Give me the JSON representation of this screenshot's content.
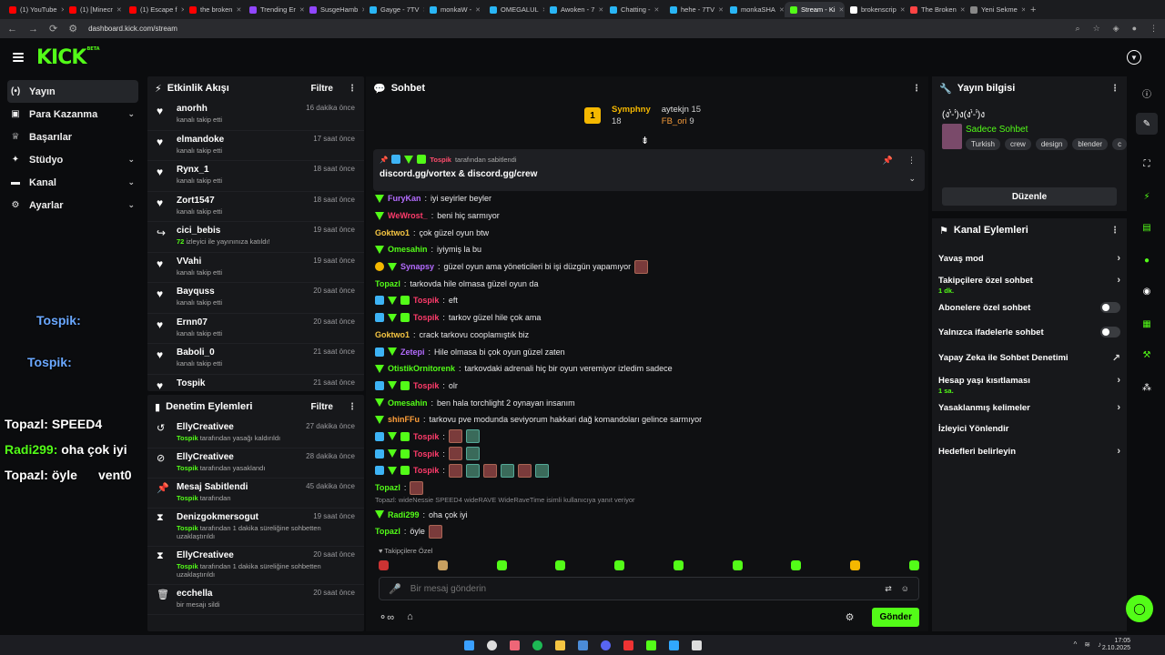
{
  "browser": {
    "tabs": [
      {
        "label": "(1) YouTube",
        "color": "#ff0000"
      },
      {
        "label": "(1) [Minecr",
        "color": "#ff0000"
      },
      {
        "label": "(1) Escape f",
        "color": "#ff0000"
      },
      {
        "label": "the broken",
        "color": "#ff0000"
      },
      {
        "label": "Trending Er",
        "color": "#9146ff"
      },
      {
        "label": "SusgeHamb",
        "color": "#9146ff"
      },
      {
        "label": "Gayge - 7TV",
        "color": "#29b6f6"
      },
      {
        "label": "monkaW -",
        "color": "#29b6f6"
      },
      {
        "label": "OMEGALUL",
        "color": "#29b6f6"
      },
      {
        "label": "Awoken - 7",
        "color": "#29b6f6"
      },
      {
        "label": "Chatting -",
        "color": "#29b6f6"
      },
      {
        "label": "hehe - 7TV",
        "color": "#29b6f6"
      },
      {
        "label": "monkaSHA",
        "color": "#29b6f6"
      },
      {
        "label": "Stream - Ki",
        "color": "#53fc18"
      },
      {
        "label": "brokenscrip",
        "color": "#ffffff"
      },
      {
        "label": "The Broken",
        "color": "#ff4444"
      },
      {
        "label": "Yeni Sekme",
        "color": "#888888"
      }
    ],
    "active_tab": 13,
    "url": "dashboard.kick.com/stream"
  },
  "brand": {
    "logo": "KICK",
    "sup": "BETA",
    "accent": "#53fc18"
  },
  "nav": {
    "items": [
      {
        "label": "Yayın",
        "icon": "broadcast-icon",
        "selected": true,
        "chev": false
      },
      {
        "label": "Para Kazanma",
        "icon": "money-icon",
        "selected": false,
        "chev": true
      },
      {
        "label": "Başarılar",
        "icon": "trophy-icon",
        "selected": false,
        "chev": false
      },
      {
        "label": "Stüdyo",
        "icon": "studio-icon",
        "selected": false,
        "chev": true
      },
      {
        "label": "Kanal",
        "icon": "channel-icon",
        "selected": false,
        "chev": true
      },
      {
        "label": "Ayarlar",
        "icon": "gear-icon",
        "selected": false,
        "chev": true
      }
    ]
  },
  "overlay": {
    "lines": [
      {
        "name": "Tospik:",
        "text": ""
      },
      {
        "name": "Tospik:",
        "text": ""
      },
      {
        "name": "Topazl:",
        "text": "SPEED4"
      },
      {
        "name": "Radi299:",
        "text": "oha çok iyi"
      },
      {
        "name": "Topazl:",
        "text": "öyle"
      },
      {
        "name": "",
        "text": "vent0"
      }
    ]
  },
  "activity": {
    "title": "Etkinlik Akışı",
    "filter": "Filtre",
    "items": [
      {
        "name": "anorhh",
        "sub": "kanalı takip etti",
        "time": "16 dakika önce",
        "icon": "heart-icon"
      },
      {
        "name": "elmandoke",
        "sub": "kanalı takip etti",
        "time": "17 saat önce",
        "icon": "heart-icon"
      },
      {
        "name": "Rynx_1",
        "sub": "kanalı takip etti",
        "time": "18 saat önce",
        "icon": "heart-icon"
      },
      {
        "name": "Zort1547",
        "sub": "kanalı takip etti",
        "time": "18 saat önce",
        "icon": "heart-icon"
      },
      {
        "name": "cici_bebis",
        "sub_num": "72",
        "sub": "izleyici ile yayınınıza katıldı!",
        "time": "19 saat önce",
        "icon": "raid-icon"
      },
      {
        "name": "VVahi",
        "sub": "kanalı takip etti",
        "time": "19 saat önce",
        "icon": "heart-icon"
      },
      {
        "name": "Bayquss",
        "sub": "kanalı takip etti",
        "time": "20 saat önce",
        "icon": "heart-icon"
      },
      {
        "name": "Ernn07",
        "sub": "kanalı takip etti",
        "time": "20 saat önce",
        "icon": "heart-icon"
      },
      {
        "name": "Baboli_0",
        "sub": "kanalı takip etti",
        "time": "21 saat önce",
        "icon": "heart-icon"
      },
      {
        "name": "Tospik",
        "sub": "",
        "time": "21 saat önce",
        "icon": "heart-icon"
      }
    ]
  },
  "moderation": {
    "title": "Denetim Eylemleri",
    "filter": "Filtre",
    "items": [
      {
        "name": "EllyCreativee",
        "actor": "Tospik",
        "sub": "tarafından yasağı kaldırıldı",
        "time": "27 dakika önce",
        "icon": "unban-icon"
      },
      {
        "name": "EllyCreativee",
        "actor": "Tospik",
        "sub": "tarafından yasaklandı",
        "time": "28 dakika önce",
        "icon": "ban-icon"
      },
      {
        "name": "Mesaj Sabitlendi",
        "actor": "Tospik",
        "sub": "tarafından",
        "time": "45 dakika önce",
        "icon": "pin-icon"
      },
      {
        "name": "Denizgokmersogut",
        "actor": "Tospik",
        "sub": "tarafından 1 dakika süreliğine sohbetten uzaklaştırıldı",
        "time": "19 saat önce",
        "icon": "timeout-icon"
      },
      {
        "name": "EllyCreativee",
        "actor": "Tospik",
        "sub": "tarafından 1 dakika süreliğine sohbetten uzaklaştırıldı",
        "time": "20 saat önce",
        "icon": "timeout-icon"
      },
      {
        "name": "ecchella",
        "actor": "",
        "sub": "bir mesajı sildi",
        "time": "20 saat önce",
        "icon": "trash-icon"
      }
    ]
  },
  "chat": {
    "title": "Sohbet",
    "gifters": [
      {
        "name": "Symphny",
        "count": "18"
      },
      {
        "name": "aytekjn",
        "count": "15"
      },
      {
        "name": "FB_ori",
        "count": "9"
      }
    ],
    "gifter_rank": "1",
    "pinned": {
      "by": "Tospik",
      "note": "tarafından sabitlendi",
      "text": "discord.gg/vortex & discord.gg/crew"
    },
    "messages": [
      {
        "user": "FuryKan",
        "color": "#b46cff",
        "text": "iyi seyirler beyler",
        "badges": [
          "vip"
        ]
      },
      {
        "user": "WeWrost_",
        "color": "#ff3b6b",
        "text": "beni hiç sarmıyor",
        "badges": [
          "vip"
        ]
      },
      {
        "user": "Goktwo1",
        "color": "#f5c542",
        "text": "çok güzel oyun btw",
        "badges": []
      },
      {
        "user": "Omesahin",
        "color": "#53fc18",
        "text": "iyiymiş la bu",
        "badges": [
          "vip"
        ]
      },
      {
        "user": "Synapsy",
        "color": "#b46cff",
        "text": "güzel oyun ama yöneticileri bi işi düzgün yapamıyor",
        "badges": [
          "og",
          "vip"
        ],
        "emote": 1
      },
      {
        "user": "Topazl",
        "color": "#53fc18",
        "text": "tarkovda hile olmasa güzel oyun da",
        "badges": []
      },
      {
        "user": "Tospik",
        "color": "#ff3b6b",
        "text": "eft",
        "badges": [
          "mod",
          "vip",
          "gift"
        ]
      },
      {
        "user": "Tospik",
        "color": "#ff3b6b",
        "text": "tarkov güzel hile çok ama",
        "badges": [
          "mod",
          "vip",
          "gift"
        ]
      },
      {
        "user": "Goktwo1",
        "color": "#f5c542",
        "text": "crack tarkovu cooplamıştık biz",
        "badges": []
      },
      {
        "user": "Zetepi",
        "color": "#b46cff",
        "text": "Hile olmasa bi çok oyun güzel zaten",
        "badges": [
          "mod",
          "vip"
        ]
      },
      {
        "user": "OtistikOrnitorenk",
        "color": "#53fc18",
        "text": "tarkovdaki adrenali hiç bir oyun veremiyor izledim sadece",
        "badges": [
          "vip"
        ]
      },
      {
        "user": "Tospik",
        "color": "#ff3b6b",
        "text": "olr",
        "badges": [
          "mod",
          "vip",
          "gift"
        ]
      },
      {
        "user": "Omesahin",
        "color": "#53fc18",
        "text": "ben hala torchlight 2 oynayan insanım",
        "badges": [
          "vip"
        ]
      },
      {
        "user": "shinFFu",
        "color": "#ff9f3a",
        "text": "tarkovu pve modunda seviyorum hakkari dağ komandoları gelince sarmıyor",
        "badges": [
          "vip"
        ]
      },
      {
        "user": "Tospik",
        "color": "#ff3b6b",
        "text": "",
        "badges": [
          "mod",
          "vip",
          "gift"
        ],
        "emote": 2
      },
      {
        "user": "Tospik",
        "color": "#ff3b6b",
        "text": "",
        "badges": [
          "mod",
          "vip",
          "gift"
        ],
        "emote": 2
      },
      {
        "user": "Tospik",
        "color": "#ff3b6b",
        "text": "",
        "badges": [
          "mod",
          "vip",
          "gift"
        ],
        "emote": 6
      },
      {
        "user": "Topazl",
        "color": "#53fc18",
        "text": "",
        "badges": [],
        "emote": 1
      }
    ],
    "reply_note": "Topazl: wideNessie SPEED4 wideRAVE WideRaveTime isimli kullanıcıya yanıt veriyor",
    "tail": [
      {
        "user": "Radi299",
        "color": "#53fc18",
        "text": "oha çok iyi",
        "badges": [
          "vip"
        ]
      },
      {
        "user": "Topazl",
        "color": "#53fc18",
        "text": "öyle",
        "badges": [],
        "emote": 1
      }
    ],
    "follow_only": "Takipçilere Özel",
    "placeholder": "Bir mesaj gönderin",
    "send": "Gönder"
  },
  "stream_info": {
    "title": "Yayın bilgisi",
    "stream_title": "(ง'̀-'́)ง(ง'̀-'́)ง",
    "category": "Sadece Sohbet",
    "tags": [
      "Turkish",
      "crew",
      "design",
      "blender",
      "c"
    ],
    "edit": "Düzenle"
  },
  "channel_actions": {
    "title": "Kanal Eylemleri",
    "items": [
      {
        "label": "Yavaş mod",
        "kind": "chev",
        "sub": ""
      },
      {
        "label": "Takipçilere özel sohbet",
        "kind": "chev",
        "sub": "1 dk."
      },
      {
        "label": "Abonelere özel sohbet",
        "kind": "toggle",
        "sub": ""
      },
      {
        "label": "Yalnızca ifadelerle sohbet",
        "kind": "toggle",
        "sub": ""
      },
      {
        "label": "Yapay Zeka ile Sohbet Denetimi",
        "kind": "ext",
        "sub": ""
      },
      {
        "label": "Hesap yaşı kısıtlaması",
        "kind": "chev",
        "sub": "1 sa."
      },
      {
        "label": "Yasaklanmış kelimeler",
        "kind": "chev",
        "sub": ""
      },
      {
        "label": "İzleyici Yönlendir",
        "kind": "none",
        "sub": ""
      },
      {
        "label": "Hedefleri belirleyin",
        "kind": "chev",
        "sub": ""
      }
    ]
  },
  "clock": {
    "time": "17:05",
    "date": "2.10.2025"
  }
}
